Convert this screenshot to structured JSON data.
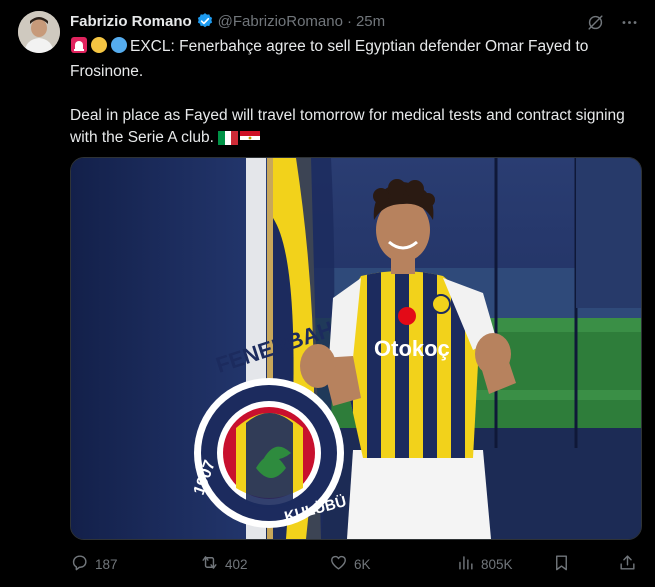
{
  "tweet": {
    "author_name": "Fabrizio Romano",
    "author_handle": "@FabrizioRomano",
    "separator": "·",
    "time": "25m",
    "line1": "EXCL: Fenerbahçe agree to sell Egyptian defender Omar Fayed to Frosinone.",
    "line2": "Deal in place as Fayed will travel tomorrow for medical tests and contract signing with the Serie A club.",
    "photo_text": {
      "sponsor": "Otokoç",
      "flag_text": "FENERBAHÇE",
      "year": "1907",
      "club": "KULÜBÜ"
    }
  },
  "stats": {
    "replies": "187",
    "reposts": "402",
    "likes": "6K",
    "views": "805K"
  },
  "colors": {
    "background": "#000000",
    "text": "#e7e9ea",
    "muted": "#71767b",
    "verified": "#1d9bf0",
    "navy": "#1c2b5e",
    "yellow": "#f2d21b"
  },
  "icons": [
    "verified-badge-icon",
    "grok-icon",
    "more-icon",
    "reply-icon",
    "repost-icon",
    "like-icon",
    "views-icon",
    "share-icon",
    "siren-emoji-icon",
    "yellow-circle-emoji-icon",
    "blue-circle-emoji-icon",
    "italy-flag-icon",
    "egypt-flag-icon"
  ]
}
